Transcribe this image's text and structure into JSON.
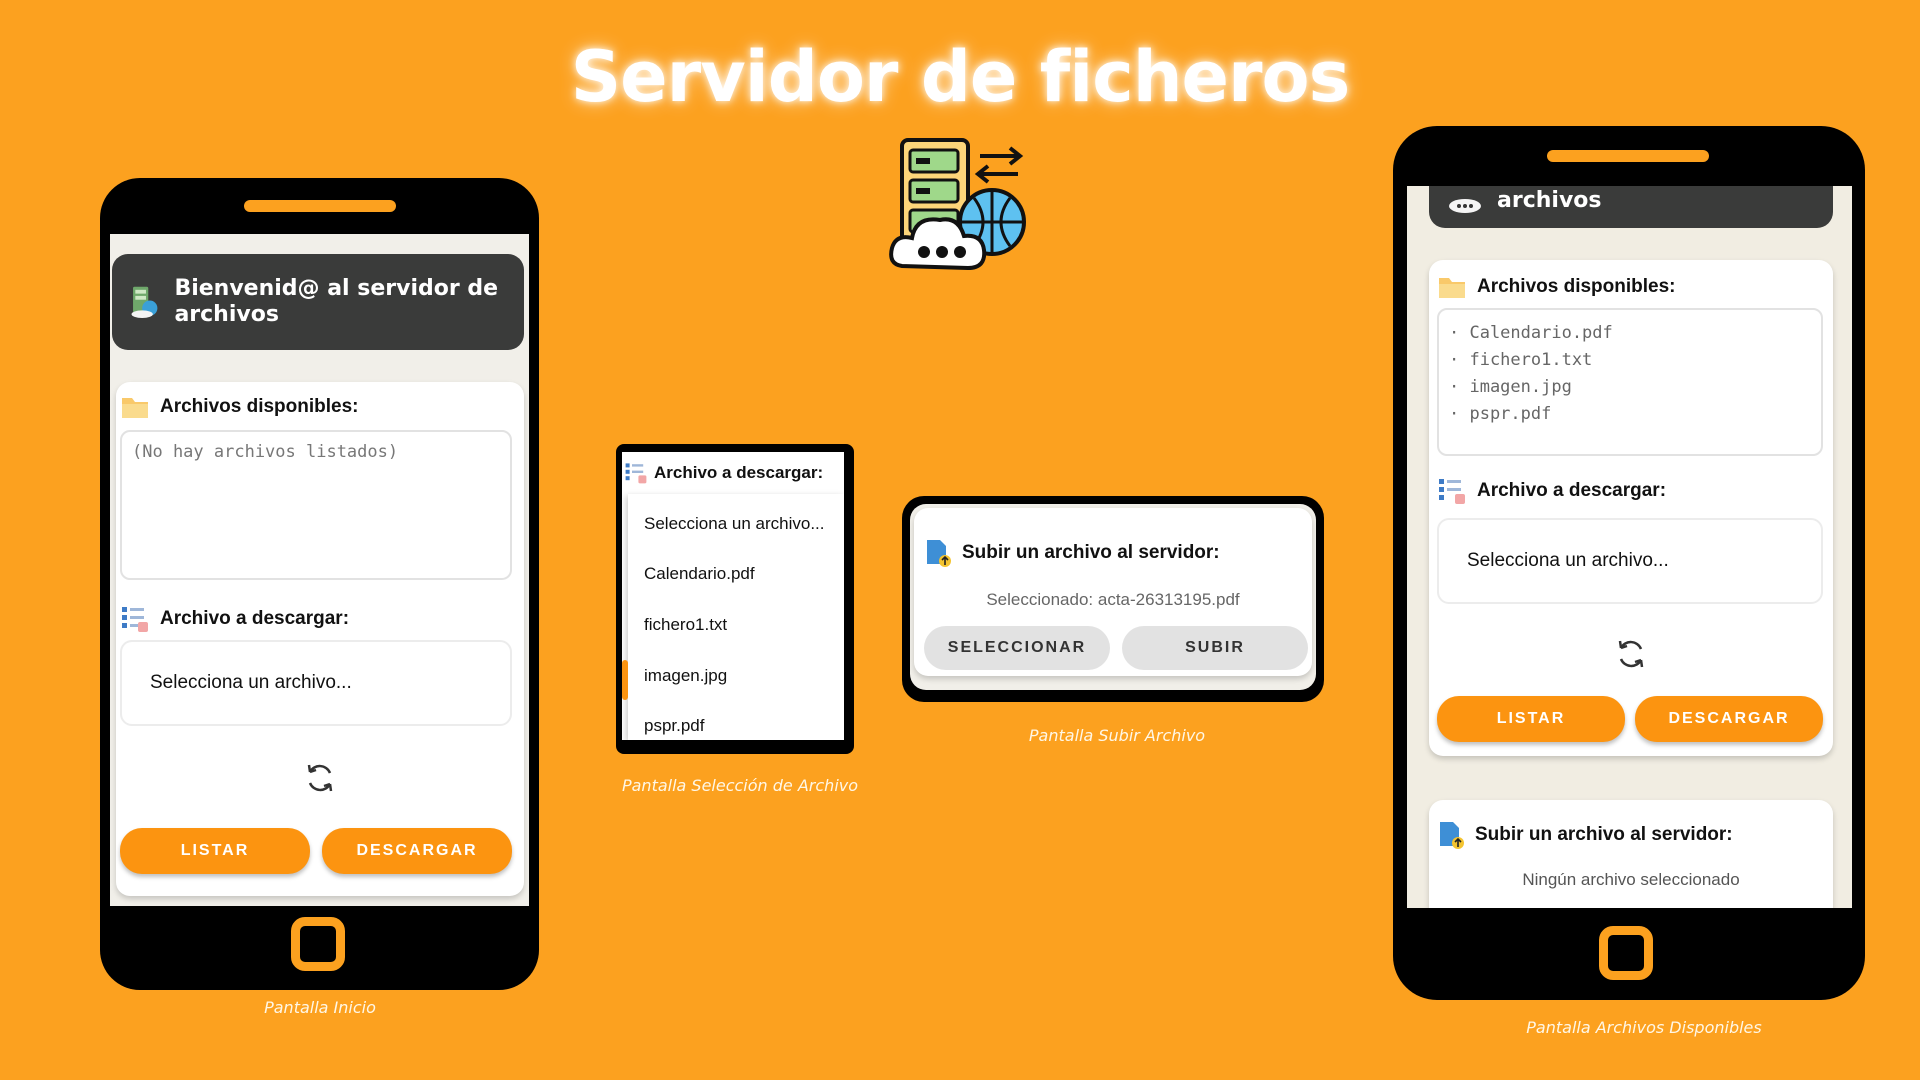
{
  "title": "Servidor de ficheros",
  "captions": {
    "inicio": "Pantalla Inicio",
    "seleccion": "Pantalla Selección de Archivo",
    "subir": "Pantalla Subir Archivo",
    "disponibles": "Pantalla Archivos Disponibles"
  },
  "colors": {
    "background": "#FCA11F",
    "accent": "#FC9410",
    "header": "#3a3b3a"
  },
  "inicio": {
    "header_title": "Bienvenid@ al servidor de archivos",
    "files_label": "Archivos disponibles:",
    "files_placeholder": "(No hay archivos listados)",
    "download_label": "Archivo a descargar:",
    "select_value": "Selecciona un archivo...",
    "listar": "LISTAR",
    "descargar": "DESCARGAR"
  },
  "seleccion": {
    "label": "Archivo a descargar:",
    "options": [
      "Selecciona un archivo...",
      "Calendario.pdf",
      "fichero1.txt",
      "imagen.jpg",
      "pspr.pdf"
    ]
  },
  "subir": {
    "label": "Subir un archivo al servidor:",
    "selected": "Seleccionado: acta-26313195.pdf",
    "seleccionar": "SELECCIONAR",
    "subir": "SUBIR"
  },
  "disponibles": {
    "header_title": "archivos",
    "files_label": "Archivos disponibles:",
    "files": [
      "· Calendario.pdf",
      "· fichero1.txt",
      "· imagen.jpg",
      "· pspr.pdf"
    ],
    "download_label": "Archivo a descargar:",
    "select_value": "Selecciona un archivo...",
    "listar": "LISTAR",
    "descargar": "DESCARGAR",
    "upload_label": "Subir un archivo al servidor:",
    "upload_status": "Ningún archivo seleccionado"
  }
}
